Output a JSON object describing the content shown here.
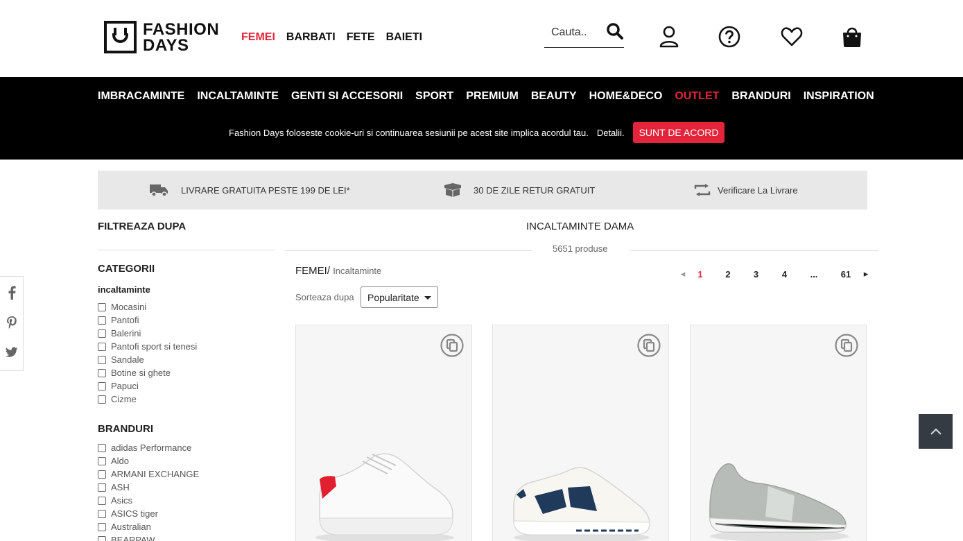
{
  "brand": {
    "logo_line1": "FASHION",
    "logo_line2": "DAYS"
  },
  "gender_nav": [
    {
      "label": "FEMEI",
      "active": true
    },
    {
      "label": "BARBATI",
      "active": false
    },
    {
      "label": "FETE",
      "active": false
    },
    {
      "label": "BAIETI",
      "active": false
    }
  ],
  "search": {
    "placeholder": "Cauta.."
  },
  "header_icons": [
    "user-icon",
    "help-icon",
    "wishlist-heart-icon",
    "shopping-bag-icon"
  ],
  "main_nav": [
    "IMBRACAMINTE",
    "INCALTAMINTE",
    "GENTI SI ACCESORII",
    "SPORT",
    "PREMIUM",
    "BEAUTY",
    "HOME&DECO",
    "OUTLET",
    "BRANDURI",
    "INSPIRATION"
  ],
  "cookie": {
    "text": "Fashion Days foloseste cookie-uri si continuarea sesiunii pe acest site implica acordul tau.",
    "details": "Detalii.",
    "button": "SUNT DE ACORD"
  },
  "benefits": [
    {
      "icon": "truck-icon",
      "label": "LIVRARE GRATUITA PESTE 199 DE LEI*"
    },
    {
      "icon": "box-icon",
      "label": "30 DE ZILE RETUR GRATUIT"
    },
    {
      "icon": "exchange-icon",
      "label": "Verificare La Livrare"
    }
  ],
  "filters": {
    "title": "FILTREAZA DUPA",
    "categories_title": "CATEGORII",
    "subcategory": "incaltaminte",
    "categories": [
      "Mocasini",
      "Pantofi",
      "Balerini",
      "Pantofi sport si tenesi",
      "Sandale",
      "Botine si ghete",
      "Papuci",
      "Cizme"
    ],
    "brands_title": "BRANDURI",
    "brands": [
      "adidas Performance",
      "Aldo",
      "ARMANI EXCHANGE",
      "ASH",
      "Asics",
      "ASICS tiger",
      "Australian",
      "BEARPAW"
    ]
  },
  "listing": {
    "title": "INCALTAMINTE DAMA",
    "count": "5651 produse",
    "breadcrumb_root": "FEMEI/",
    "breadcrumb_sub": "Incaltaminte",
    "sort_label": "Sorteaza dupa",
    "sort_value": "Popularitate",
    "pages": [
      "1",
      "2",
      "3",
      "4",
      "...",
      "61"
    ],
    "current_page": "1"
  },
  "social": [
    "facebook-icon",
    "pinterest-icon",
    "twitter-icon"
  ],
  "colors": {
    "accent": "#e4243a",
    "nav_bg": "#000000",
    "benefits_bg": "#e8e8e8"
  }
}
